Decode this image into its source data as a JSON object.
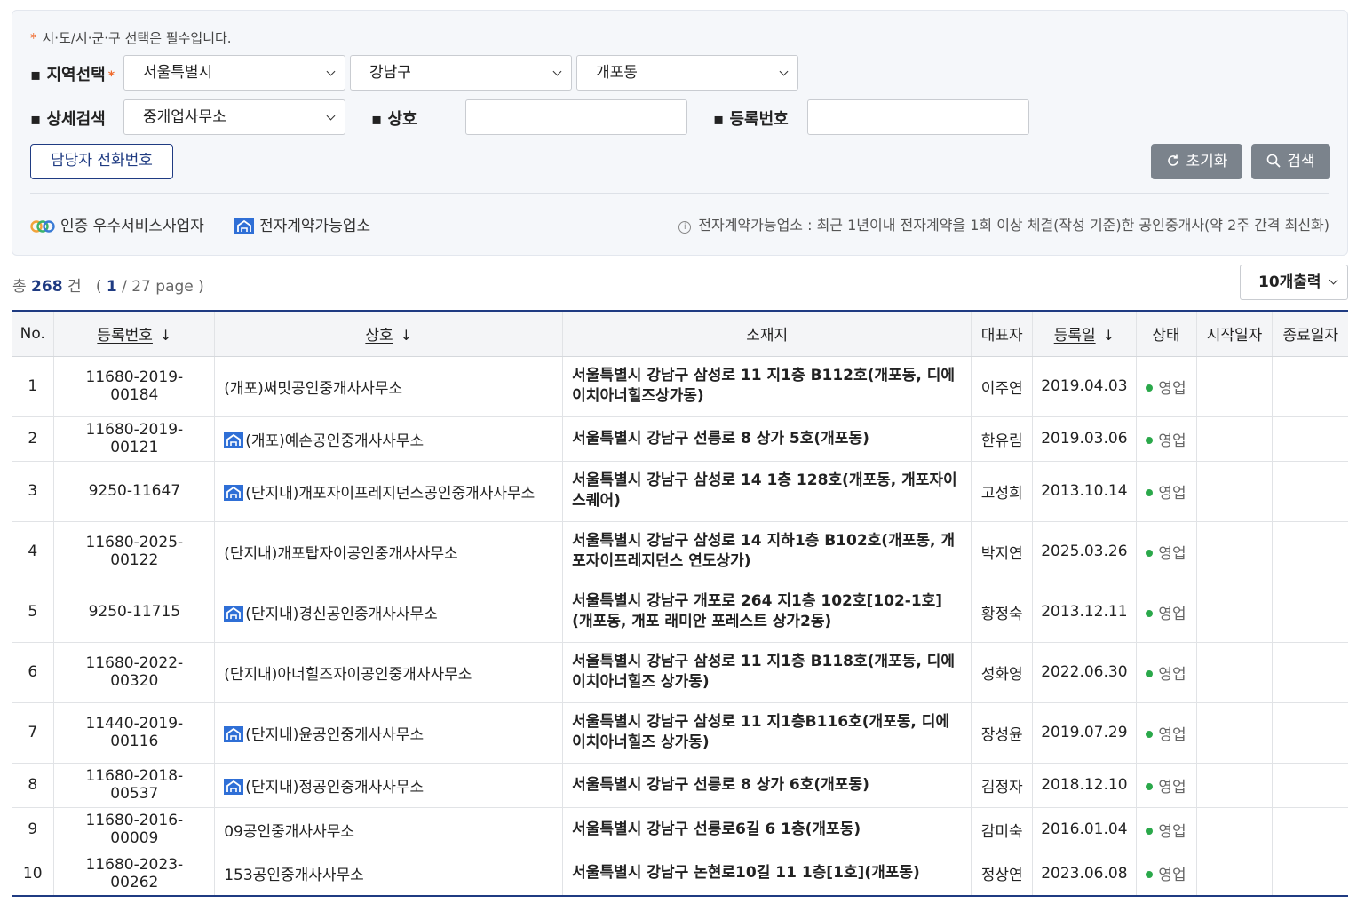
{
  "search": {
    "required_note": "시·도/시·군·구 선택은 필수입니다.",
    "required_mark": "*",
    "region_label": "지역선택",
    "detail_label": "상세검색",
    "name_label": "상호",
    "reg_no_label": "등록번호",
    "sido": "서울특별시",
    "sigungu": "강남구",
    "dong": "개포동",
    "detail_type": "중개업사무소",
    "name_value": "",
    "reg_no_value": "",
    "phone_button": "담당자 전화번호",
    "reset_button": "초기화",
    "search_button": "검색"
  },
  "legend": {
    "certified": "인증 우수서비스사업자",
    "econtract": "전자계약가능업소",
    "notice": "전자계약가능업소 : 최근 1년이내 전자계약을 1회 이상 체결(작성 기준)한 공인중개사(약 2주 간격 최신화)"
  },
  "summary": {
    "prefix": "총",
    "total": "268",
    "unit": "건",
    "page_open": "(",
    "current_page": "1",
    "page_rest": "/ 27 page )",
    "per_page": "10개출력"
  },
  "table": {
    "headers": {
      "no": "No.",
      "reg_no": "등록번호",
      "name": "상호",
      "address": "소재지",
      "rep": "대표자",
      "reg_date": "등록일",
      "status": "상태",
      "start": "시작일자",
      "end": "종료일자"
    },
    "sort_arrow": "↓",
    "rows": [
      {
        "no": "1",
        "reg_no": "11680-2019-00184",
        "econtract": false,
        "name": "(개포)써밋공인중개사사무소",
        "address": "서울특별시 강남구 삼성로 11 지1층 B112호(개포동, 디에이치아너힐즈상가동)",
        "rep": "이주연",
        "reg_date": "2019.04.03",
        "status": "영업",
        "start": "",
        "end": ""
      },
      {
        "no": "2",
        "reg_no": "11680-2019-00121",
        "econtract": true,
        "name": "(개포)예손공인중개사사무소",
        "address": "서울특별시 강남구 선릉로 8 상가 5호(개포동)",
        "rep": "한유림",
        "reg_date": "2019.03.06",
        "status": "영업",
        "start": "",
        "end": ""
      },
      {
        "no": "3",
        "reg_no": "9250-11647",
        "econtract": true,
        "name": "(단지내)개포자이프레지던스공인중개사사무소",
        "address": "서울특별시 강남구 삼성로 14 1층 128호(개포동, 개포자이스퀘어)",
        "rep": "고성희",
        "reg_date": "2013.10.14",
        "status": "영업",
        "start": "",
        "end": ""
      },
      {
        "no": "4",
        "reg_no": "11680-2025-00122",
        "econtract": false,
        "name": "(단지내)개포탑자이공인중개사사무소",
        "address": "서울특별시 강남구 삼성로 14 지하1층 B102호(개포동, 개포자이프레지던스 연도상가)",
        "rep": "박지연",
        "reg_date": "2025.03.26",
        "status": "영업",
        "start": "",
        "end": ""
      },
      {
        "no": "5",
        "reg_no": "9250-11715",
        "econtract": true,
        "name": "(단지내)경신공인중개사사무소",
        "address": "서울특별시 강남구 개포로 264 지1층 102호[102-1호](개포동, 개포 래미안 포레스트 상가2동)",
        "rep": "황정숙",
        "reg_date": "2013.12.11",
        "status": "영업",
        "start": "",
        "end": ""
      },
      {
        "no": "6",
        "reg_no": "11680-2022-00320",
        "econtract": false,
        "name": "(단지내)아너힐즈자이공인중개사사무소",
        "address": "서울특별시 강남구 삼성로 11 지1층 B118호(개포동, 디에이치아너힐즈 상가동)",
        "rep": "성화영",
        "reg_date": "2022.06.30",
        "status": "영업",
        "start": "",
        "end": ""
      },
      {
        "no": "7",
        "reg_no": "11440-2019-00116",
        "econtract": true,
        "name": "(단지내)윤공인중개사사무소",
        "address": "서울특별시 강남구 삼성로 11 지1층B116호(개포동, 디에이치아너힐즈 상가동)",
        "rep": "장성윤",
        "reg_date": "2019.07.29",
        "status": "영업",
        "start": "",
        "end": ""
      },
      {
        "no": "8",
        "reg_no": "11680-2018-00537",
        "econtract": true,
        "name": "(단지내)정공인중개사사무소",
        "address": "서울특별시 강남구 선릉로 8 상가 6호(개포동)",
        "rep": "김정자",
        "reg_date": "2018.12.10",
        "status": "영업",
        "start": "",
        "end": ""
      },
      {
        "no": "9",
        "reg_no": "11680-2016-00009",
        "econtract": false,
        "name": "09공인중개사사무소",
        "address": "서울특별시 강남구 선릉로6길 6 1층(개포동)",
        "rep": "감미숙",
        "reg_date": "2016.01.04",
        "status": "영업",
        "start": "",
        "end": ""
      },
      {
        "no": "10",
        "reg_no": "11680-2023-00262",
        "econtract": false,
        "name": "153공인중개사사무소",
        "address": "서울특별시 강남구 논현로10길 11 1층[1호](개포동)",
        "rep": "정상연",
        "reg_date": "2023.06.08",
        "status": "영업",
        "start": "",
        "end": ""
      }
    ]
  },
  "colors": {
    "accent": "#1f3b82",
    "required": "#f06a2c",
    "status_active": "#2aa84a",
    "button_gray": "#7b838c",
    "econtract_icon": "#2f6fd6"
  },
  "icons": {
    "econtract": "econtract-house-icon",
    "certified": "certified-ring-icon",
    "reset": "refresh-icon",
    "search": "search-icon",
    "info": "info-icon"
  }
}
